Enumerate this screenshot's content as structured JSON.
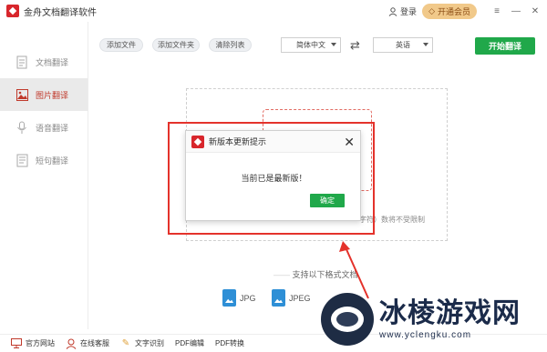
{
  "app": {
    "title": "金舟文档翻译软件",
    "login_label": "登录",
    "vip_label": "开通会员"
  },
  "sidebar": {
    "items": [
      {
        "label": "文档翻译",
        "icon": "document-icon"
      },
      {
        "label": "图片翻译",
        "icon": "image-icon",
        "active": true
      },
      {
        "label": "语音翻译",
        "icon": "microphone-icon"
      },
      {
        "label": "短句翻译",
        "icon": "text-icon"
      }
    ]
  },
  "toolbar": {
    "add_file": "添加文件",
    "add_folder": "添加文件夹",
    "clear_list": "清除列表",
    "source_lang": "简体中文",
    "target_lang": "英语",
    "start_label": "开始翻译"
  },
  "drop": {
    "limit_text": "字符）数将不受限制"
  },
  "formats": {
    "title": "支持以下格式文档",
    "items": [
      "JPG",
      "JPEG"
    ]
  },
  "bottombar": {
    "items": [
      {
        "label": "官方网站",
        "icon": "monitor-icon"
      },
      {
        "label": "在线客服",
        "icon": "headset-icon"
      },
      {
        "label": "文字识别",
        "icon": "ocr-icon"
      },
      {
        "label": "PDF编辑",
        "icon": ""
      },
      {
        "label": "PDF转换",
        "icon": ""
      }
    ]
  },
  "dialog": {
    "title": "新版本更新提示",
    "message": "当前已是最新版！",
    "ok_label": "确定"
  },
  "watermark": {
    "title": "冰棱游戏网",
    "url": "www.yclengku.com"
  },
  "colors": {
    "accent_green": "#20a84a",
    "brand_red": "#d8262c",
    "highlight_red": "#e4322b"
  }
}
